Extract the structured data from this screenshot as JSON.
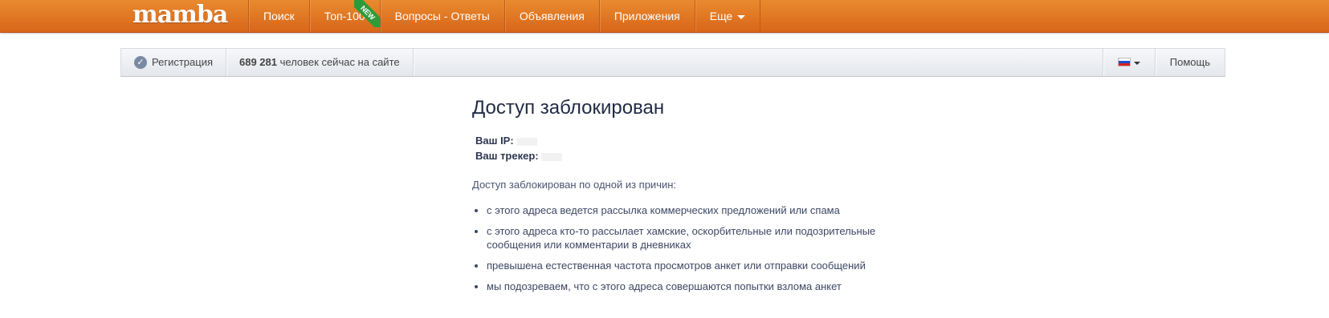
{
  "header": {
    "logo": "mamba",
    "nav": [
      {
        "label": "Поиск"
      },
      {
        "label": "Топ-100",
        "badge": "NEW"
      },
      {
        "label": "Вопросы - Ответы"
      },
      {
        "label": "Объявления"
      },
      {
        "label": "Приложения"
      },
      {
        "label": "Еще"
      }
    ]
  },
  "subbar": {
    "register": "Регистрация",
    "online_count": "689 281",
    "online_text": "человек сейчас на сайте",
    "help": "Помощь",
    "language_flag": "flag-ru-icon"
  },
  "content": {
    "title": "Доступ заблокирован",
    "ip_label": "Ваш IP:",
    "tracker_label": "Ваш трекер:",
    "intro": "Доступ заблокирован по одной из причин:",
    "reasons": [
      "с этого адреса ведется рассылка коммерческих предложений или спама",
      "с этого адреса кто-то рассылает хамские, оскорбительные или подозрительные сообщения или комментарии в дневниках",
      "превышена естественная частота просмотров анкет или отправки сообщений",
      "мы подозреваем, что с этого адреса совершаются попытки взлома анкет"
    ]
  },
  "colors": {
    "topbar": "#de7422",
    "new_badge": "#2f9a3a",
    "title": "#1f2a44"
  }
}
